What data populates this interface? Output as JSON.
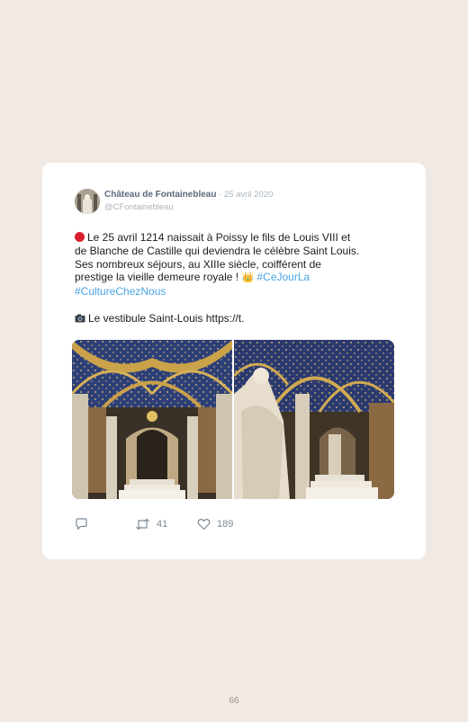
{
  "tweet": {
    "author_name": "Château de Fontainebleau",
    "separator": " · ",
    "date": "25 avril 2020",
    "handle": "@CFontainebleau",
    "lines": {
      "l1": "Le 25 avril 1214 naissait à Poissy le fils de Louis VIII et",
      "l2": "de Blanche de Castille qui deviendra le célèbre Saint Louis.",
      "l3": "Ses nombreux séjours, au XIIIe siècle, coifférent de",
      "l4": "prestige la vieille demeure royale !",
      "crown": "👑",
      "hashtag1": "#CeJourLa",
      "hashtag2": "#CultureChezNous",
      "l5": "Le vestibule Saint-Louis https://t."
    },
    "actions": {
      "retweets": "41",
      "likes": "189"
    }
  },
  "colors": {
    "background": "#f1e9e4",
    "card": "#ffffff",
    "link": "#4aa5e4",
    "name": "#5a6b7b",
    "muted": "#a9b4bd",
    "red_emoji": "#d81f30"
  },
  "icons": [
    "avatar",
    "red-circle-icon",
    "crown-icon",
    "camera-icon",
    "reply-icon",
    "retweet-icon",
    "heart-icon"
  ],
  "page": {
    "number": "66"
  }
}
